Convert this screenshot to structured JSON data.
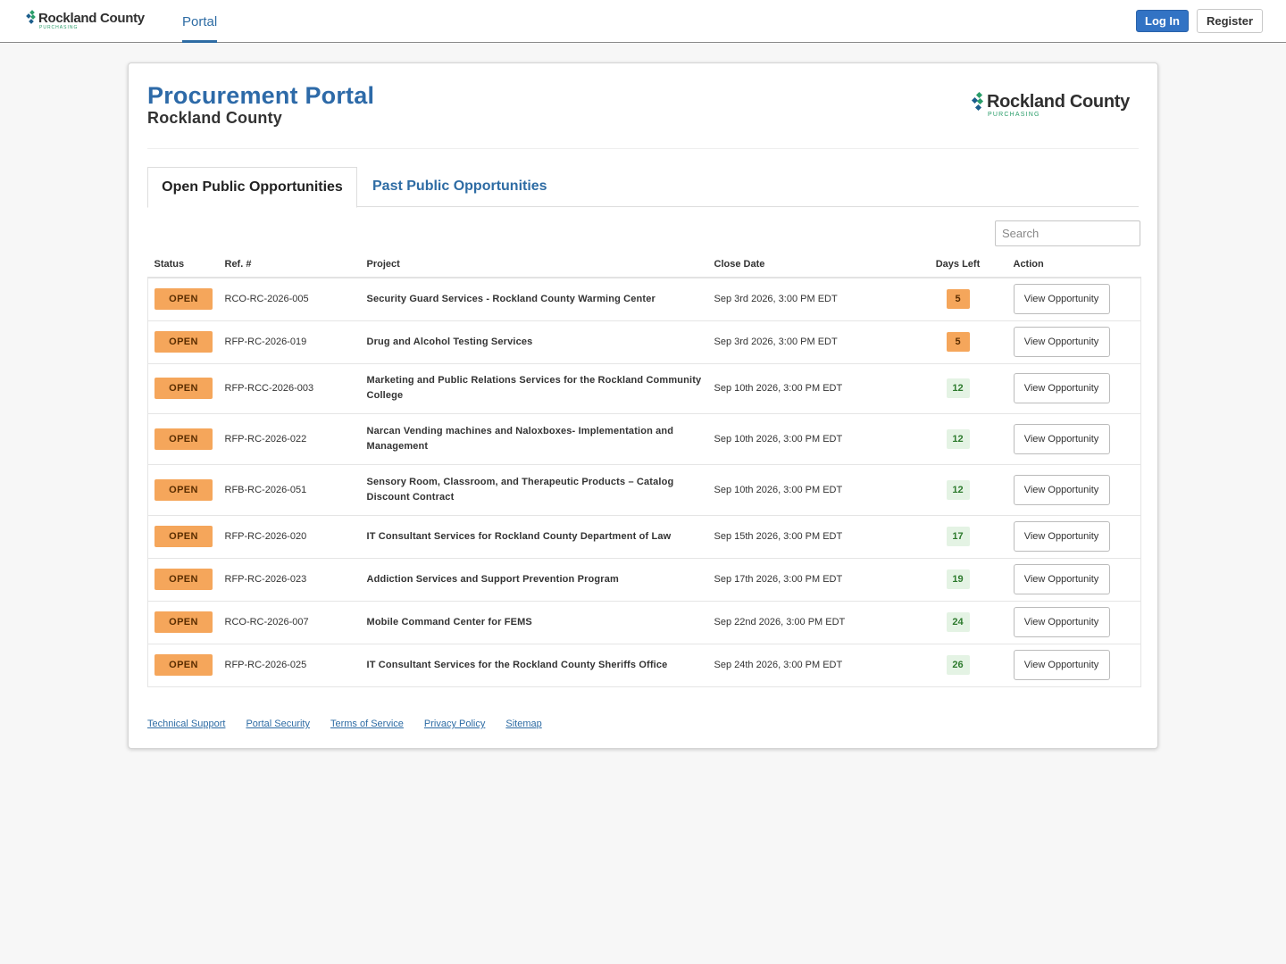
{
  "nav": {
    "logo_brand": "Rockland County",
    "logo_sub": "PURCHASING",
    "tab_portal": "Portal",
    "login": "Log In",
    "register": "Register"
  },
  "header": {
    "title": "Procurement Portal",
    "subtitle": "Rockland County",
    "logo_brand": "Rockland County",
    "logo_sub": "PURCHASING"
  },
  "tabs": {
    "open": "Open Public Opportunities",
    "past": "Past Public Opportunities"
  },
  "search": {
    "placeholder": "Search"
  },
  "table": {
    "columns": {
      "status": "Status",
      "ref": "Ref. #",
      "project": "Project",
      "close_date": "Close Date",
      "days_left": "Days Left",
      "action": "Action"
    },
    "rows": [
      {
        "status": "OPEN",
        "ref": "RCO-RC-2026-005",
        "project": "Security Guard Services - Rockland County Warming Center",
        "close": "Sep 3rd 2026, 3:00 PM EDT",
        "days": "5",
        "action": "View Opportunity"
      },
      {
        "status": "OPEN",
        "ref": "RFP-RC-2026-019",
        "project": "Drug and Alcohol Testing Services",
        "close": "Sep 3rd 2026, 3:00 PM EDT",
        "days": "5",
        "action": "View Opportunity"
      },
      {
        "status": "OPEN",
        "ref": "RFP-RCC-2026-003",
        "project": "Marketing and Public Relations Services for the Rockland Community College",
        "close": "Sep 10th 2026, 3:00 PM EDT",
        "days": "12",
        "action": "View Opportunity"
      },
      {
        "status": "OPEN",
        "ref": "RFP-RC-2026-022",
        "project": "Narcan Vending machines and Naloxboxes- Implementation and Management",
        "close": "Sep 10th 2026, 3:00 PM EDT",
        "days": "12",
        "action": "View Opportunity"
      },
      {
        "status": "OPEN",
        "ref": "RFB-RC-2026-051",
        "project": "Sensory Room, Classroom, and Therapeutic Products – Catalog Discount Contract",
        "close": "Sep 10th 2026, 3:00 PM EDT",
        "days": "12",
        "action": "View Opportunity"
      },
      {
        "status": "OPEN",
        "ref": "RFP-RC-2026-020",
        "project": "IT Consultant Services for Rockland County Department of Law",
        "close": "Sep 15th 2026, 3:00 PM EDT",
        "days": "17",
        "action": "View Opportunity"
      },
      {
        "status": "OPEN",
        "ref": "RFP-RC-2026-023",
        "project": "Addiction Services and Support Prevention Program",
        "close": "Sep 17th 2026, 3:00 PM EDT",
        "days": "19",
        "action": "View Opportunity"
      },
      {
        "status": "OPEN",
        "ref": "RCO-RC-2026-007",
        "project": "Mobile Command Center for FEMS",
        "close": "Sep 22nd 2026, 3:00 PM EDT",
        "days": "24",
        "action": "View Opportunity"
      },
      {
        "status": "OPEN",
        "ref": "RFP-RC-2026-025",
        "project": "IT Consultant Services for the Rockland County Sheriffs Office",
        "close": "Sep 24th 2026, 3:00 PM EDT",
        "days": "26",
        "action": "View Opportunity"
      }
    ]
  },
  "footer": {
    "links": [
      "Technical Support",
      "Portal Security",
      "Terms of Service",
      "Privacy Policy",
      "Sitemap"
    ]
  },
  "colors": {
    "brand_blue": "#2e6ca4",
    "login_blue": "#3273c4",
    "open_badge": "#f5a65b",
    "days_ok_bg": "#e4f3e4",
    "days_ok_text": "#2d7a2d",
    "logo_green": "#2a9d6a"
  },
  "icons": {
    "logo": "rockland-diamond-logo-icon"
  }
}
